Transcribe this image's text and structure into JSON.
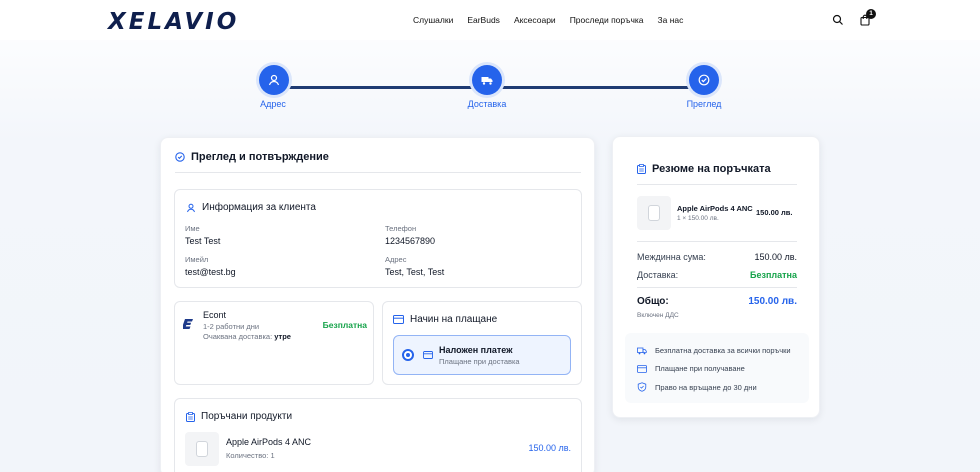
{
  "header": {
    "logo": "XELAVIO",
    "nav": [
      "Слушалки",
      "EarBuds",
      "Аксесоари",
      "Проследи поръчка",
      "За нас"
    ],
    "cart_count": "1"
  },
  "stepper": {
    "steps": [
      {
        "label": "Адрес",
        "icon": "location-user-icon"
      },
      {
        "label": "Доставка",
        "icon": "truck-icon"
      },
      {
        "label": "Преглед",
        "icon": "check-circle-icon"
      }
    ]
  },
  "review": {
    "title": "Преглед и потвърждение",
    "customer": {
      "title": "Информация за клиента",
      "name_label": "Име",
      "name": "Test Test",
      "phone_label": "Телефон",
      "phone": "1234567890",
      "email_label": "Имейл",
      "email": "test@test.bg",
      "address_label": "Адрес",
      "address": "Test, Test, Test"
    },
    "shipping": {
      "carrier": "Econt",
      "days": "1-2 работни дни",
      "expected_label": "Очаквана доставка:",
      "expected": "утре",
      "price": "Безплатна"
    },
    "payment": {
      "title": "Начин на плащане",
      "option_title": "Наложен платеж",
      "option_sub": "Плащане при доставка"
    },
    "products": {
      "title": "Поръчани продукти",
      "items": [
        {
          "name": "Apple AirPods 4 ANC",
          "qty": "Количество: 1",
          "price": "150.00 лв."
        }
      ]
    }
  },
  "summary": {
    "title": "Резюме на поръчката",
    "item_name": "Apple AirPods 4 ANC",
    "item_qty": "1 × 150.00 лв.",
    "item_price": "150.00 лв.",
    "subtotal_label": "Междинна сума:",
    "subtotal": "150.00 лв.",
    "delivery_label": "Доставка:",
    "delivery": "Безплатна",
    "total_label": "Общо:",
    "total": "150.00 лв.",
    "vat_note": "Включен ДДС",
    "perks": [
      "Безплатна доставка за всички поръчки",
      "Плащане при получаване",
      "Право на връщане до 30 дни"
    ]
  },
  "colors": {
    "accent": "#2563eb",
    "success": "#16a34a",
    "dark": "#111827"
  }
}
